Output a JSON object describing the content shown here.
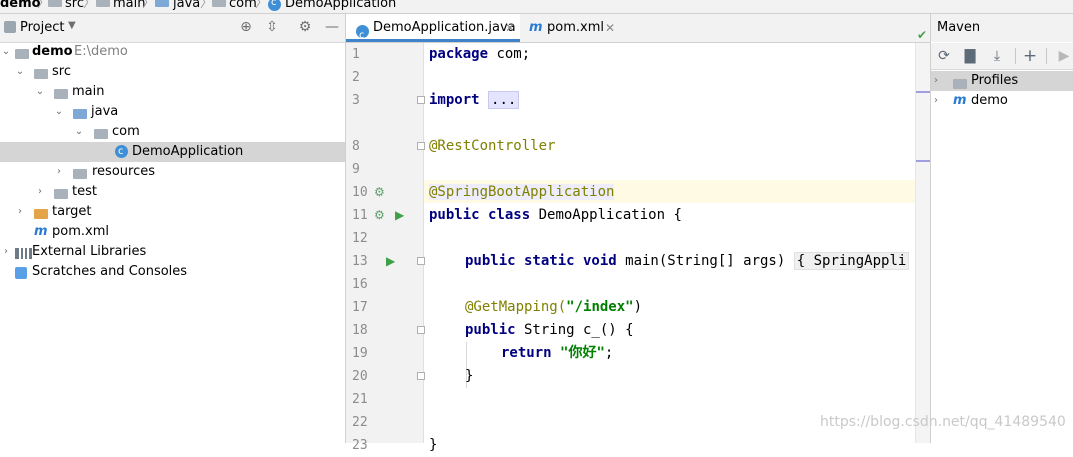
{
  "breadcrumb": [
    "demo",
    "src",
    "main",
    "java",
    "com",
    "DemoApplication"
  ],
  "project": {
    "title": "Project",
    "tree": [
      {
        "label": "demo",
        "path": "E:\\demo"
      },
      {
        "label": "src"
      },
      {
        "label": "main"
      },
      {
        "label": "java"
      },
      {
        "label": "com"
      },
      {
        "label": "DemoApplication"
      },
      {
        "label": "resources"
      },
      {
        "label": "test"
      },
      {
        "label": "target"
      },
      {
        "label": "pom.xml"
      },
      {
        "label": "External Libraries"
      },
      {
        "label": "Scratches and Consoles"
      }
    ],
    "xml_glyph": "m"
  },
  "editor": {
    "tabs": [
      {
        "label": "DemoApplication.java"
      },
      {
        "label": "pom.xml"
      }
    ],
    "line_numbers": [
      "1",
      "2",
      "3",
      "8",
      "9",
      "10",
      "11",
      "12",
      "13",
      "16",
      "17",
      "18",
      "19",
      "20",
      "21",
      "22",
      "23"
    ],
    "code": {
      "l1_kw": "package",
      "l1_rest": " com;",
      "l3_kw": "import",
      "l3_fold": "...",
      "l8_ann": "@RestController",
      "l10_ann": "@SpringBootApplication",
      "l11_kw": "public class",
      "l11_rest": " DemoApplication {",
      "l13_kw": "public static void",
      "l13_rest": " main(String[] args) ",
      "l13_fold": "{ SpringAppli",
      "l17_ann": "@GetMapping(",
      "l17_str": "\"/index\"",
      "l17_end": ")",
      "l18_kw": "public",
      "l18_rest": " String c_() {",
      "l19_kw": "return",
      "l19_str": "\"你好\"",
      "l19_end": ";",
      "l20": "}",
      "l23": "}"
    }
  },
  "maven": {
    "title": "Maven",
    "items": [
      {
        "label": "Profiles"
      },
      {
        "label": "demo"
      }
    ]
  },
  "watermark": "https://blog.csdn.net/qq_41489540",
  "colors": {
    "accent": "#4083c9",
    "keyword": "#000080",
    "annotation": "#808000",
    "string": "#008000"
  }
}
